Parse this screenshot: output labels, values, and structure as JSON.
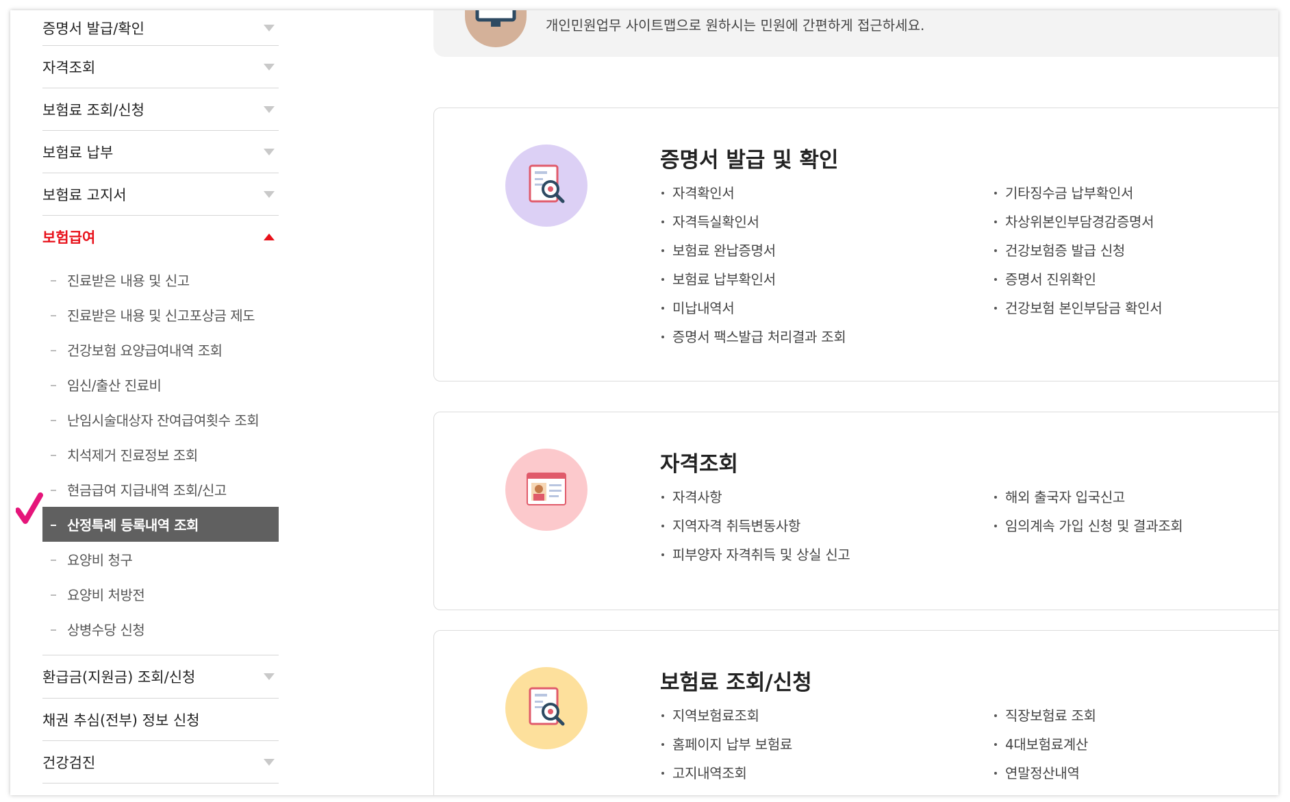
{
  "sidebar": {
    "top_items": [
      {
        "label": "증명서 발급/확인"
      },
      {
        "label": "자격조회"
      },
      {
        "label": "보험료 조회/신청"
      },
      {
        "label": "보험료 납부"
      },
      {
        "label": "보험료 고지서"
      }
    ],
    "active_item": {
      "label": "보험급여"
    },
    "sub_items": [
      {
        "label": "진료받은 내용 및 신고"
      },
      {
        "label": "진료받은 내용 및 신고포상금 제도"
      },
      {
        "label": "건강보험 요양급여내역 조회"
      },
      {
        "label": "임신/출산 진료비"
      },
      {
        "label": "난임시술대상자 잔여급여횟수 조회"
      },
      {
        "label": "치석제거 진료정보 조회"
      },
      {
        "label": "현금급여 지급내역 조회/신고"
      },
      {
        "label": "산정특례 등록내역 조회"
      },
      {
        "label": "요양비 청구"
      },
      {
        "label": "요양비 처방전"
      },
      {
        "label": "상병수당 신청"
      }
    ],
    "selected_sub_index": 7,
    "bottom_items": [
      {
        "label": "환급금(지원금) 조회/신청",
        "arrow": true
      },
      {
        "label": "채권 추심(전부) 정보 신청",
        "arrow": false
      },
      {
        "label": "건강검진",
        "arrow": true
      }
    ]
  },
  "banner": {
    "text": "개인민원업무 사이트맵으로 원하시는 민원에 간편하게 접근하세요.",
    "icon": "monitor-icon"
  },
  "cards": [
    {
      "title": "증명서 발급 및 확인",
      "icon": "certificate-search-icon",
      "icon_bg": "#dcd0f5",
      "left_links": [
        "자격확인서",
        "자격득실확인서",
        "보험료 완납증명서",
        "보험료 납부확인서",
        "미납내역서",
        "증명서 팩스발급 처리결과 조회"
      ],
      "right_links": [
        "기타징수금 납부확인서",
        "차상위본인부담경감증명서",
        "건강보험증 발급 신청",
        "증명서 진위확인",
        "건강보험 본인부담금 확인서"
      ]
    },
    {
      "title": "자격조회",
      "icon": "id-card-icon",
      "icon_bg": "#fcc9cc",
      "left_links": [
        "자격사항",
        "지역자격 취득변동사항",
        "피부양자 자격취득 및 상실 신고"
      ],
      "right_links": [
        "해외 출국자 입국신고",
        "임의계속 가입 신청 및 결과조회"
      ]
    },
    {
      "title": "보험료 조회/신청",
      "icon": "document-search-icon",
      "icon_bg": "#fde09c",
      "left_links": [
        "지역보험료조회",
        "홈페이지 납부 보험료",
        "고지내역조회"
      ],
      "right_links": [
        "직장보험료 조회",
        "4대보험료계산",
        "연말정산내역"
      ]
    }
  ],
  "colors": {
    "active_red": "#e8111a",
    "selected_bg": "#606060",
    "checkmark": "#e5157a"
  }
}
